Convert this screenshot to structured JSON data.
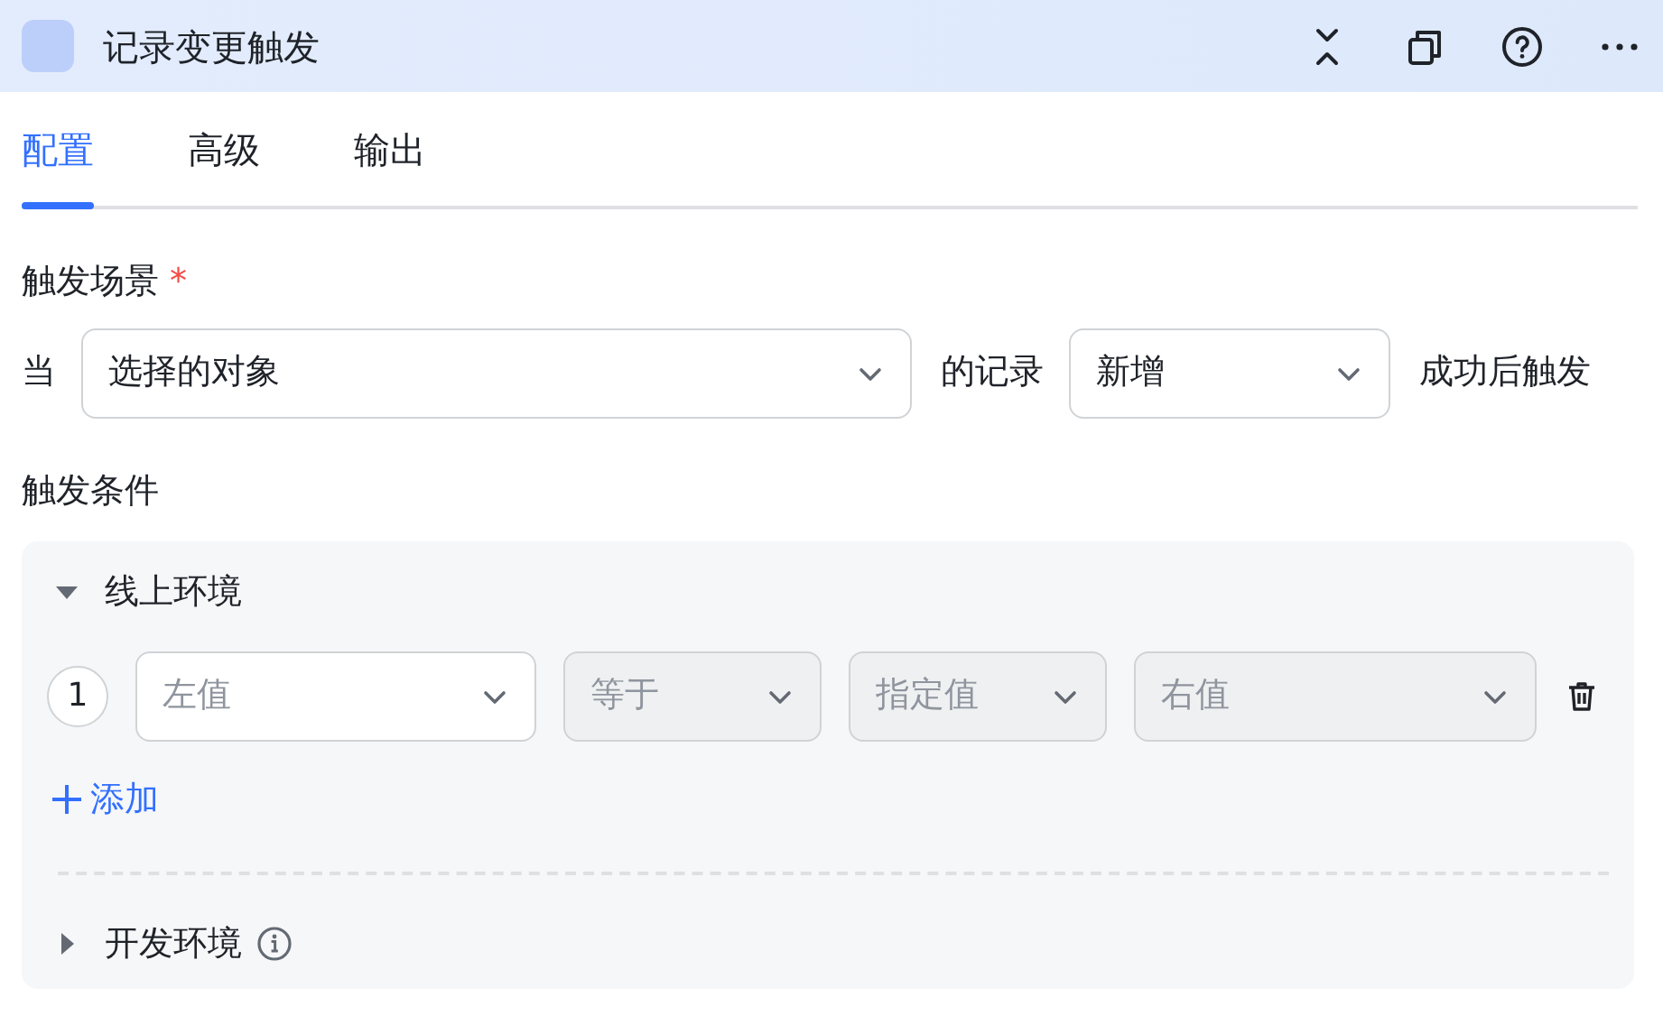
{
  "window": {
    "title": "记录变更触发"
  },
  "tabs": [
    {
      "label": "配置",
      "selected": true
    },
    {
      "label": "高级",
      "selected": false
    },
    {
      "label": "输出",
      "selected": false
    }
  ],
  "trigger_scene": {
    "label": "触发场景",
    "required_mark": "*",
    "parts": [
      {
        "kind": "text",
        "text": "当"
      },
      {
        "kind": "select",
        "value": "选择的对象"
      },
      {
        "kind": "text",
        "text": "的记录"
      },
      {
        "kind": "select",
        "value": "新增"
      },
      {
        "kind": "text",
        "text": "成功后触发"
      }
    ]
  },
  "conditions": {
    "label": "触发条件",
    "environments": [
      {
        "name": "线上环境",
        "expanded": true,
        "info": false,
        "rows": [
          {
            "index": "1",
            "fields": [
              {
                "placeholder": "左值",
                "disabled": false
              },
              {
                "placeholder": "等于",
                "disabled": true
              },
              {
                "placeholder": "指定值",
                "disabled": true
              },
              {
                "placeholder": "右值",
                "disabled": true
              }
            ]
          }
        ],
        "add_label": "添加"
      },
      {
        "name": "开发环境",
        "expanded": false,
        "info": true
      }
    ]
  }
}
